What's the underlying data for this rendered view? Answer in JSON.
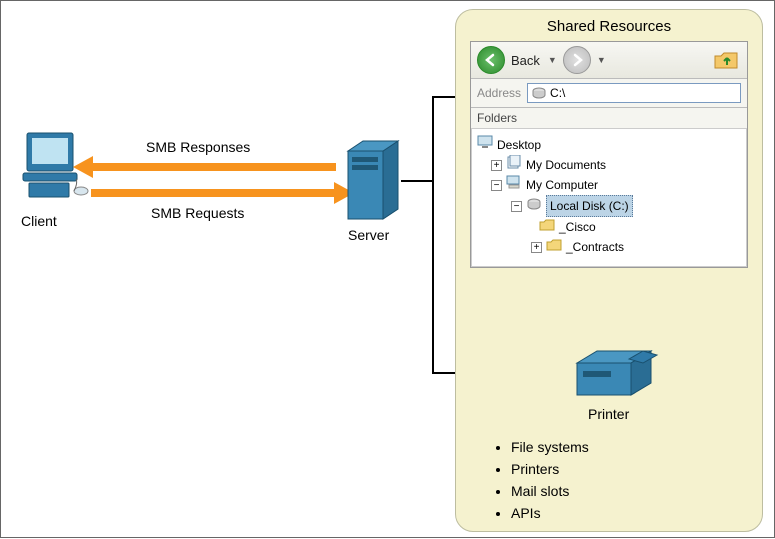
{
  "client": {
    "label": "Client"
  },
  "server": {
    "label": "Server"
  },
  "smb": {
    "responses": "SMB Responses",
    "requests": "SMB Requests"
  },
  "panel": {
    "title": "Shared Resources",
    "toolbar": {
      "back_label": "Back"
    },
    "address": {
      "label": "Address",
      "value": "C:\\"
    },
    "folders_header": "Folders",
    "tree": {
      "desktop": "Desktop",
      "my_documents": "My Documents",
      "my_computer": "My Computer",
      "local_disk": "Local Disk (C:)",
      "cisco": "_Cisco",
      "contracts": "_Contracts"
    },
    "printer_label": "Printer",
    "bullets": [
      "File systems",
      "Printers",
      "Mail slots",
      "APIs"
    ]
  },
  "icons": {
    "back": "back-nav-icon",
    "forward": "forward-nav-icon",
    "up_folder": "up-folder-icon",
    "disk": "disk-icon",
    "desktop": "desktop-icon",
    "folder": "folder-icon",
    "computer": "computer-icon"
  }
}
